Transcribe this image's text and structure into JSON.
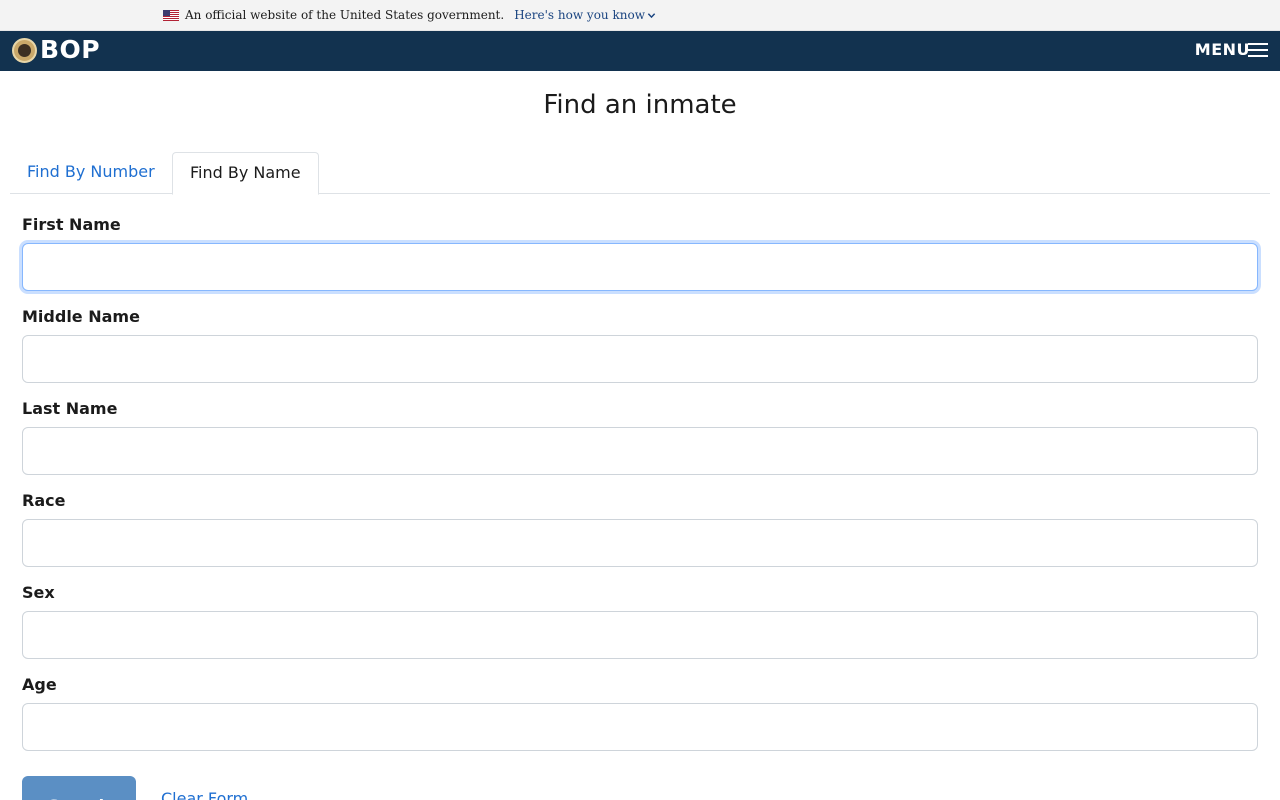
{
  "gov_banner": {
    "text": "An official website of the United States government.",
    "link": "Here's how you know",
    "flag_icon": "us-flag-icon",
    "chevron_icon": "chevron-down-icon"
  },
  "header": {
    "brand": "BOP",
    "menu_label": "MENU",
    "seal_icon": "bop-seal-icon",
    "menu_icon": "hamburger-icon",
    "bg_color": "#12324f"
  },
  "page": {
    "title": "Find an inmate"
  },
  "tabs": [
    {
      "label": "Find By Number",
      "active": false
    },
    {
      "label": "Find By Name",
      "active": true
    }
  ],
  "form": {
    "fields": [
      {
        "label": "First Name",
        "value": "",
        "focused": true
      },
      {
        "label": "Middle Name",
        "value": ""
      },
      {
        "label": "Last Name",
        "value": ""
      },
      {
        "label": "Race",
        "value": ""
      },
      {
        "label": "Sex",
        "value": ""
      },
      {
        "label": "Age",
        "value": ""
      }
    ],
    "search_label": "Search",
    "clear_label": "Clear Form"
  },
  "colors": {
    "link": "#1f6fd1",
    "button": "#5b8fc4"
  }
}
